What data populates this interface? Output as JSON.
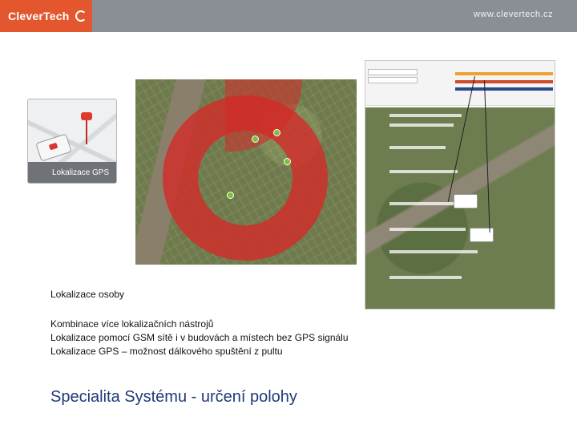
{
  "header": {
    "brand": "CleverTech",
    "url": "www.clevertech.cz"
  },
  "card": {
    "label": "Lokalizace GPS"
  },
  "content": {
    "caption": "Lokalizace osoby",
    "lines": [
      "Kombinace více lokalizačních nástrojů",
      "Lokalizace pomocí GSM sítě i v budovách a místech bez GPS signálu",
      "Lokalizace GPS – možnost dálkového spuštění z pultu"
    ],
    "title": "Specialita Systému - určení polohy"
  },
  "colors": {
    "brand": "#e4572e",
    "header": "#8a8f96",
    "title": "#1f3a7a",
    "zone": "#d62828"
  },
  "icons": {
    "logo": "c-logo-icon",
    "pin": "map-pin-icon"
  }
}
